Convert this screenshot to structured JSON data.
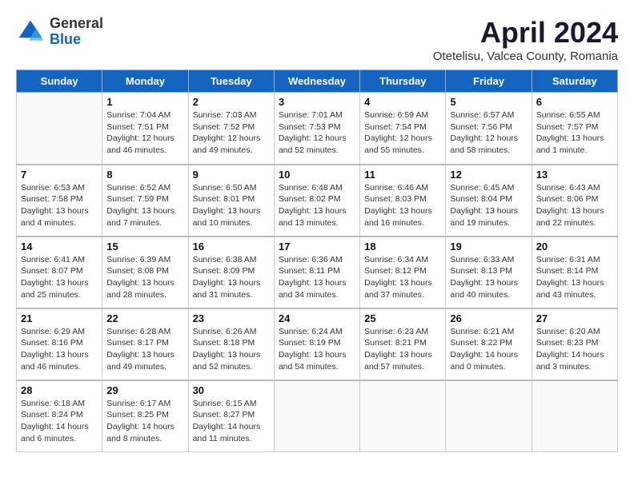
{
  "header": {
    "logo_general": "General",
    "logo_blue": "Blue",
    "month": "April 2024",
    "location": "Otetelisu, Valcea County, Romania"
  },
  "days_of_week": [
    "Sunday",
    "Monday",
    "Tuesday",
    "Wednesday",
    "Thursday",
    "Friday",
    "Saturday"
  ],
  "weeks": [
    [
      {
        "day": "",
        "info": ""
      },
      {
        "day": "1",
        "info": "Sunrise: 7:04 AM\nSunset: 7:51 PM\nDaylight: 12 hours\nand 46 minutes."
      },
      {
        "day": "2",
        "info": "Sunrise: 7:03 AM\nSunset: 7:52 PM\nDaylight: 12 hours\nand 49 minutes."
      },
      {
        "day": "3",
        "info": "Sunrise: 7:01 AM\nSunset: 7:53 PM\nDaylight: 12 hours\nand 52 minutes."
      },
      {
        "day": "4",
        "info": "Sunrise: 6:59 AM\nSunset: 7:54 PM\nDaylight: 12 hours\nand 55 minutes."
      },
      {
        "day": "5",
        "info": "Sunrise: 6:57 AM\nSunset: 7:56 PM\nDaylight: 12 hours\nand 58 minutes."
      },
      {
        "day": "6",
        "info": "Sunrise: 6:55 AM\nSunset: 7:57 PM\nDaylight: 13 hours\nand 1 minute."
      }
    ],
    [
      {
        "day": "7",
        "info": "Sunrise: 6:53 AM\nSunset: 7:58 PM\nDaylight: 13 hours\nand 4 minutes."
      },
      {
        "day": "8",
        "info": "Sunrise: 6:52 AM\nSunset: 7:59 PM\nDaylight: 13 hours\nand 7 minutes."
      },
      {
        "day": "9",
        "info": "Sunrise: 6:50 AM\nSunset: 8:01 PM\nDaylight: 13 hours\nand 10 minutes."
      },
      {
        "day": "10",
        "info": "Sunrise: 6:48 AM\nSunset: 8:02 PM\nDaylight: 13 hours\nand 13 minutes."
      },
      {
        "day": "11",
        "info": "Sunrise: 6:46 AM\nSunset: 8:03 PM\nDaylight: 13 hours\nand 16 minutes."
      },
      {
        "day": "12",
        "info": "Sunrise: 6:45 AM\nSunset: 8:04 PM\nDaylight: 13 hours\nand 19 minutes."
      },
      {
        "day": "13",
        "info": "Sunrise: 6:43 AM\nSunset: 8:06 PM\nDaylight: 13 hours\nand 22 minutes."
      }
    ],
    [
      {
        "day": "14",
        "info": "Sunrise: 6:41 AM\nSunset: 8:07 PM\nDaylight: 13 hours\nand 25 minutes."
      },
      {
        "day": "15",
        "info": "Sunrise: 6:39 AM\nSunset: 8:08 PM\nDaylight: 13 hours\nand 28 minutes."
      },
      {
        "day": "16",
        "info": "Sunrise: 6:38 AM\nSunset: 8:09 PM\nDaylight: 13 hours\nand 31 minutes."
      },
      {
        "day": "17",
        "info": "Sunrise: 6:36 AM\nSunset: 8:11 PM\nDaylight: 13 hours\nand 34 minutes."
      },
      {
        "day": "18",
        "info": "Sunrise: 6:34 AM\nSunset: 8:12 PM\nDaylight: 13 hours\nand 37 minutes."
      },
      {
        "day": "19",
        "info": "Sunrise: 6:33 AM\nSunset: 8:13 PM\nDaylight: 13 hours\nand 40 minutes."
      },
      {
        "day": "20",
        "info": "Sunrise: 6:31 AM\nSunset: 8:14 PM\nDaylight: 13 hours\nand 43 minutes."
      }
    ],
    [
      {
        "day": "21",
        "info": "Sunrise: 6:29 AM\nSunset: 8:16 PM\nDaylight: 13 hours\nand 46 minutes."
      },
      {
        "day": "22",
        "info": "Sunrise: 6:28 AM\nSunset: 8:17 PM\nDaylight: 13 hours\nand 49 minutes."
      },
      {
        "day": "23",
        "info": "Sunrise: 6:26 AM\nSunset: 8:18 PM\nDaylight: 13 hours\nand 52 minutes."
      },
      {
        "day": "24",
        "info": "Sunrise: 6:24 AM\nSunset: 8:19 PM\nDaylight: 13 hours\nand 54 minutes."
      },
      {
        "day": "25",
        "info": "Sunrise: 6:23 AM\nSunset: 8:21 PM\nDaylight: 13 hours\nand 57 minutes."
      },
      {
        "day": "26",
        "info": "Sunrise: 6:21 AM\nSunset: 8:22 PM\nDaylight: 14 hours\nand 0 minutes."
      },
      {
        "day": "27",
        "info": "Sunrise: 6:20 AM\nSunset: 8:23 PM\nDaylight: 14 hours\nand 3 minutes."
      }
    ],
    [
      {
        "day": "28",
        "info": "Sunrise: 6:18 AM\nSunset: 8:24 PM\nDaylight: 14 hours\nand 6 minutes."
      },
      {
        "day": "29",
        "info": "Sunrise: 6:17 AM\nSunset: 8:25 PM\nDaylight: 14 hours\nand 8 minutes."
      },
      {
        "day": "30",
        "info": "Sunrise: 6:15 AM\nSunset: 8:27 PM\nDaylight: 14 hours\nand 11 minutes."
      },
      {
        "day": "",
        "info": ""
      },
      {
        "day": "",
        "info": ""
      },
      {
        "day": "",
        "info": ""
      },
      {
        "day": "",
        "info": ""
      }
    ]
  ]
}
